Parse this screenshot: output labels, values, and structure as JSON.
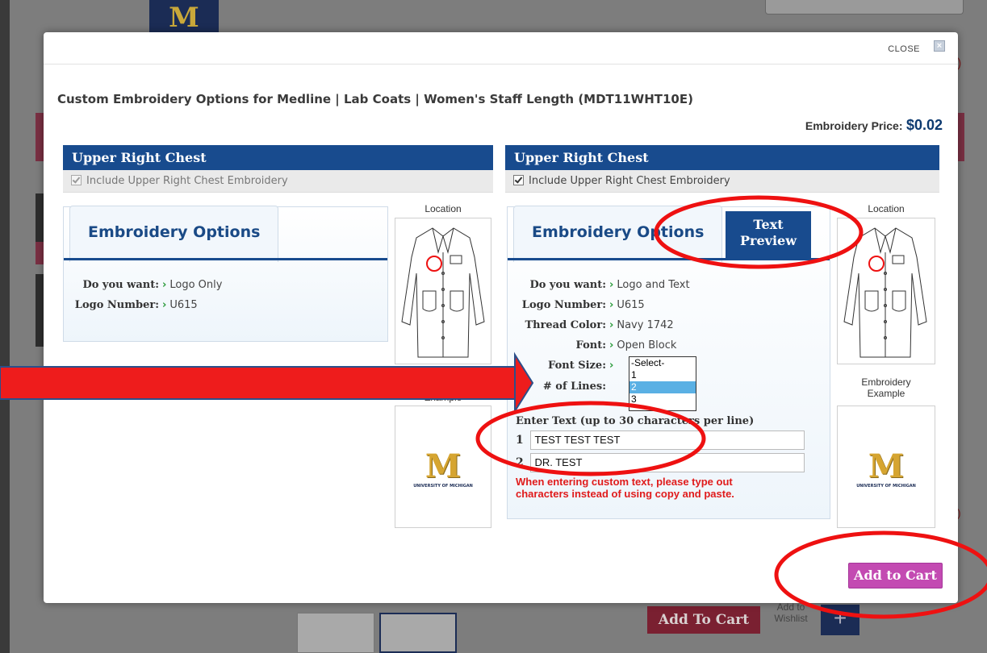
{
  "background": {
    "logo_letter": "M",
    "add_to_cart_label": "Add To Cart",
    "wishlist_label": "Add to Wishlist",
    "paren": ")"
  },
  "modal": {
    "close_label": "CLOSE",
    "close_icon": "close-x-icon",
    "title": "Custom Embroidery Options for Medline | Lab Coats | Women's Staff Length (MDT11WHT10E)",
    "price_label": "Embroidery Price:",
    "price_value": "$0.02",
    "add_to_cart_label": "Add to Cart",
    "accent_color": "#184b8e",
    "button_color": "#c34ab2"
  },
  "left_panel": {
    "header": "Upper Right Chest",
    "include_label": "Include Upper Right Chest Embroidery",
    "include_checked": true,
    "tab_label": "Embroidery Options",
    "options": [
      {
        "label": "Do you want:",
        "value": "Logo Only"
      },
      {
        "label": "Logo Number:",
        "value": "U615"
      }
    ],
    "location_caption": "Location",
    "example_caption": "Example",
    "logo_sub": "UNIVERSITY OF MICHIGAN"
  },
  "right_panel": {
    "header": "Upper Right Chest",
    "include_label": "Include Upper Right Chest Embroidery",
    "include_checked": true,
    "tab_label": "Embroidery Options",
    "tab_preview_line1": "Text",
    "tab_preview_line2": "Preview",
    "options": [
      {
        "label": "Do you want:",
        "value": "Logo and Text"
      },
      {
        "label": "Logo Number:",
        "value": "U615"
      },
      {
        "label": "Thread Color:",
        "value": "Navy 1742"
      },
      {
        "label": "Font:",
        "value": "Open Block"
      },
      {
        "label": "Font Size:",
        "value": ""
      },
      {
        "label": "# of Lines:",
        "value": ""
      }
    ],
    "lines_options": [
      "-Select-",
      "1",
      "2",
      "3"
    ],
    "lines_selected": "2",
    "enter_text_label": "Enter Text (up to 30 characters per line)",
    "text_lines": [
      {
        "num": "1",
        "value": "TEST TEST TEST"
      },
      {
        "num": "2",
        "value": "DR. TEST"
      }
    ],
    "warning_line1": "When entering custom text, please type out",
    "warning_line2": "characters instead of using copy and paste.",
    "location_caption": "Location",
    "example_caption_line1": "Embroidery",
    "example_caption_line2": "Example",
    "logo_sub": "UNIVERSITY OF MICHIGAN"
  }
}
